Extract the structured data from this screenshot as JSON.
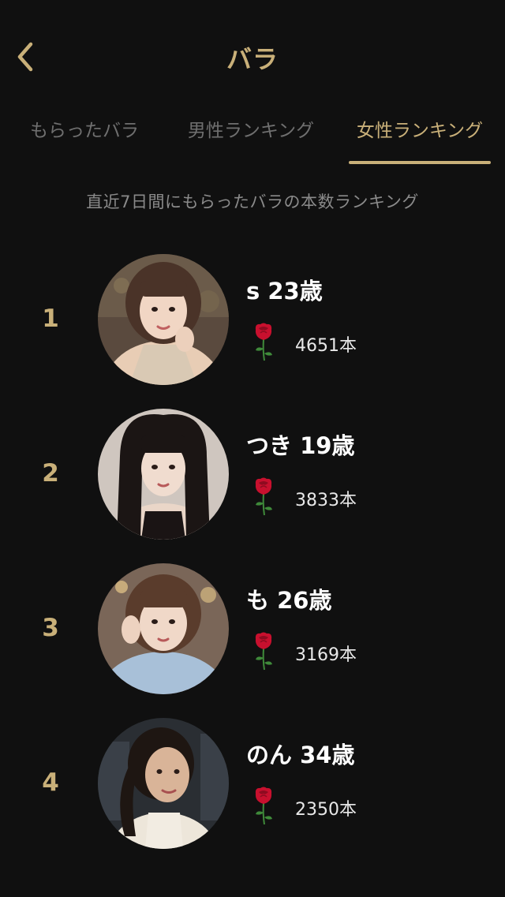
{
  "header": {
    "title": "バラ"
  },
  "tabs": [
    {
      "label": "もらったバラ"
    },
    {
      "label": "男性ランキング"
    },
    {
      "label": "女性ランキング"
    }
  ],
  "subtitle": "直近7日間にもらったバラの本数ランキング",
  "ranking": [
    {
      "rank": "1",
      "name_age": "s 23歳",
      "count": "4651本"
    },
    {
      "rank": "2",
      "name_age": "つき 19歳",
      "count": "3833本"
    },
    {
      "rank": "3",
      "name_age": "も 26歳",
      "count": "3169本"
    },
    {
      "rank": "4",
      "name_age": "のん 34歳",
      "count": "2350本"
    }
  ],
  "colors": {
    "background": "#101010",
    "accent_gold": "#c9b079",
    "rose_red": "#c8102e"
  },
  "icons": {
    "back": "chevron-left-icon",
    "rose": "rose-icon"
  }
}
